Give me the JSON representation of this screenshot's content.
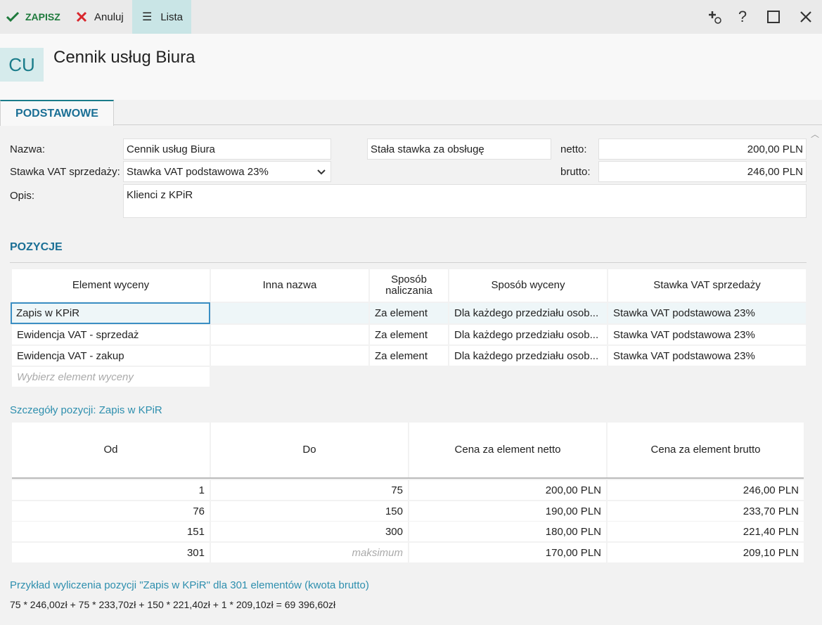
{
  "toolbar": {
    "save_label": "ZAPISZ",
    "cancel_label": "Anuluj",
    "list_label": "Lista"
  },
  "header": {
    "badge": "CU",
    "title": "Cennik usług Biura"
  },
  "tabs": [
    {
      "label": "PODSTAWOWE",
      "active": true
    }
  ],
  "form": {
    "name_label": "Nazwa:",
    "name_value": "Cennik usług Biura",
    "vat_label": "Stawka VAT sprzedaży:",
    "vat_value": "Stawka VAT podstawowa 23%",
    "desc_label": "Opis:",
    "desc_value": "Klienci z KPiR",
    "fixed_rate_value": "Stała stawka za obsługę",
    "net_label": "netto:",
    "net_value": "200,00 PLN",
    "gross_label": "brutto:",
    "gross_value": "246,00 PLN"
  },
  "positions": {
    "title": "POZYCJE",
    "columns": [
      "Element wyceny",
      "Inna nazwa",
      "Sposób naliczania",
      "Sposób wyceny",
      "Stawka VAT sprzedaży"
    ],
    "rows": [
      [
        "Zapis w KPiR",
        "",
        "Za element",
        "Dla każdego przedziału osob...",
        "Stawka VAT podstawowa 23%"
      ],
      [
        "Ewidencja VAT - sprzedaż",
        "",
        "Za element",
        "Dla każdego przedziału osob...",
        "Stawka VAT podstawowa 23%"
      ],
      [
        "Ewidencja VAT - zakup",
        "",
        "Za element",
        "Dla każdego przedziału osob...",
        "Stawka VAT podstawowa 23%"
      ]
    ],
    "new_placeholder": "Wybierz element wyceny"
  },
  "details": {
    "title": "Szczegóły pozycji: Zapis w KPiR",
    "columns": [
      "Od",
      "Do",
      "Cena za element netto",
      "Cena za element brutto"
    ],
    "rows": [
      [
        "1",
        "75",
        "200,00 PLN",
        "246,00 PLN"
      ],
      [
        "76",
        "150",
        "190,00 PLN",
        "233,70 PLN"
      ],
      [
        "151",
        "300",
        "180,00 PLN",
        "221,40 PLN"
      ],
      [
        "301",
        "maksimum",
        "170,00 PLN",
        "209,10 PLN"
      ]
    ]
  },
  "example": {
    "title": "Przykład wyliczenia pozycji \"Zapis w KPiR\" dla 301 elementów (kwota brutto)",
    "formula": "75 * 246,00zł + 75 * 233,70zł + 150 * 221,40zł + 1 * 209,10zł = 69 396,60zł"
  },
  "colors": {
    "accent": "#1a7c8a",
    "link": "#2e8fae",
    "save": "#1e7a3c",
    "cancel": "#d9262c"
  }
}
